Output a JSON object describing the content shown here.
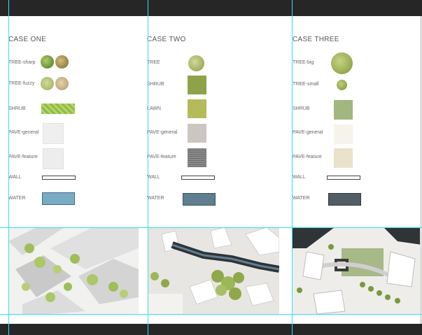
{
  "cases": [
    {
      "title": "CASE ONE",
      "labels": [
        "TREE-sharp",
        "TREE-fuzzy",
        "SHRUB",
        "PAVE-general",
        "PAVE-feature",
        "WALL",
        "WATER"
      ]
    },
    {
      "title": "CASE TWO",
      "labels": [
        "TREE",
        "SHRUB",
        "LAWN",
        "PAVE-general",
        "PAVE-feature",
        "WALL",
        "WATER"
      ]
    },
    {
      "title": "CASE THREE",
      "labels": [
        "TREE-big",
        "TREE-small",
        "SHRUB",
        "PAVE-general",
        "PAVE-feature",
        "WALL",
        "WATER"
      ]
    }
  ],
  "colors": {
    "canvas_bg": "#ffffff",
    "workspace_bg": "#262626",
    "guide": "#34e0ee",
    "case1_water": "#79abc5",
    "case2_shrub": "#8ea24a",
    "case2_lawn": "#b5bb5a",
    "case2_pave_general": "#cbc6bf",
    "case2_water": "#5f7f8f",
    "case3_shrub": "#a2b77f",
    "case3_pave_general": "#f6f3ea",
    "case3_pave_feature": "#ebe2cc",
    "case3_water": "#525e66"
  }
}
